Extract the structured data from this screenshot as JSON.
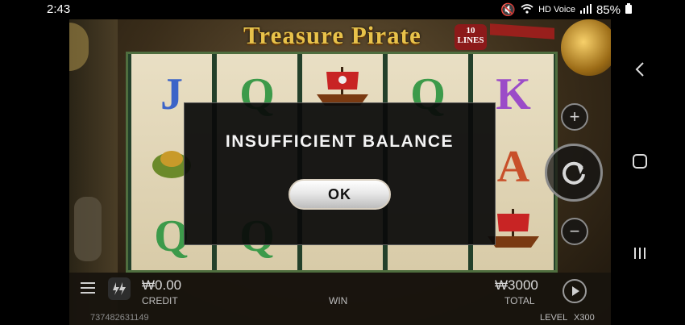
{
  "status": {
    "time": "2:43",
    "hd_label": "HD Voice",
    "battery": "85%"
  },
  "game": {
    "title": "Treasure Pirate",
    "lines_badge": "10 LINES",
    "reels": [
      [
        "J",
        "",
        "Q"
      ],
      [
        "Q",
        "",
        "Q"
      ],
      [
        "",
        "",
        ""
      ],
      [
        "Q",
        "",
        ""
      ],
      [
        "K",
        "A",
        ""
      ]
    ]
  },
  "dialog": {
    "message": "INSUFFICIENT BALANCE",
    "ok_label": "OK"
  },
  "bottom_bar": {
    "credit_amount": "₩0.00",
    "credit_label": "CREDIT",
    "win_label": "WIN",
    "total_amount": "₩3000",
    "total_label": "TOTAL",
    "account_id": "737482631149",
    "level_label": "LEVEL",
    "level_value": "X300"
  },
  "icons": [
    "menu-icon",
    "turbo-icon",
    "plus-icon",
    "spin-icon",
    "minus-icon",
    "autoplay-icon",
    "back-icon",
    "home-icon",
    "recents-icon"
  ]
}
